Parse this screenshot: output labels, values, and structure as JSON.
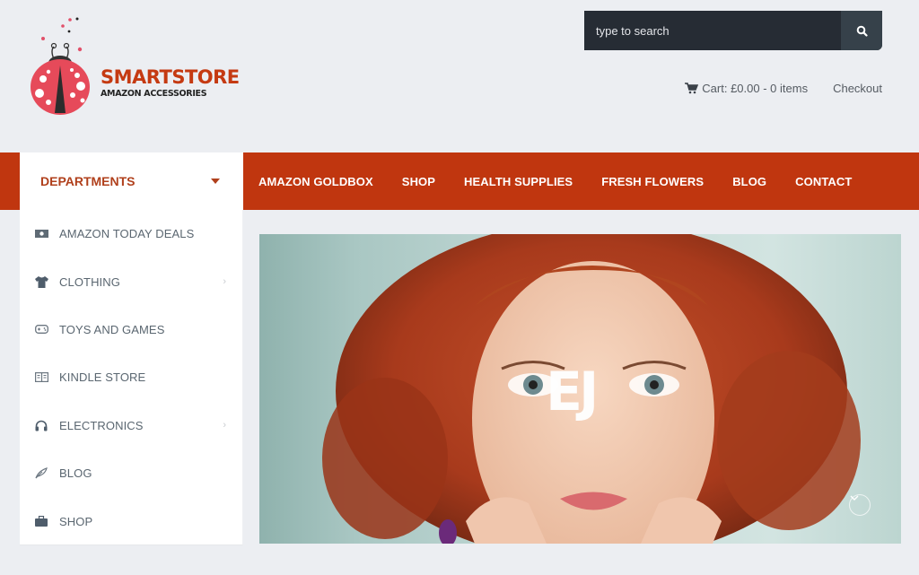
{
  "brand": {
    "name": "SMARTSTORE",
    "tagline": "AMAZON ACCESSORIES",
    "primary_color": "#c0360f",
    "logo_icon": "ladybug-icon"
  },
  "header": {
    "search": {
      "placeholder": "type to search",
      "value": "",
      "icon": "search-icon"
    },
    "cart": {
      "icon": "cart-icon",
      "label": "Cart: £0.00 - 0 items"
    },
    "checkout_label": "Checkout"
  },
  "nav": {
    "departments_label": "DEPARTMENTS",
    "items": [
      {
        "label": "AMAZON GOLDBOX"
      },
      {
        "label": "SHOP"
      },
      {
        "label": "HEALTH SUPPLIES"
      },
      {
        "label": "FRESH FLOWERS"
      },
      {
        "label": "BLOG"
      },
      {
        "label": "CONTACT"
      }
    ]
  },
  "sidebar": {
    "items": [
      {
        "label": "AMAZON TODAY DEALS",
        "icon": "money-icon",
        "has_submenu": false
      },
      {
        "label": "CLOTHING",
        "icon": "tshirt-icon",
        "has_submenu": true
      },
      {
        "label": "TOYS AND GAMES",
        "icon": "gamepad-icon",
        "has_submenu": false
      },
      {
        "label": "KINDLE STORE",
        "icon": "book-icon",
        "has_submenu": false
      },
      {
        "label": "ELECTRONICS",
        "icon": "headphones-icon",
        "has_submenu": true
      },
      {
        "label": "BLOG",
        "icon": "feather-icon",
        "has_submenu": false
      },
      {
        "label": "SHOP",
        "icon": "briefcase-icon",
        "has_submenu": false
      }
    ]
  },
  "hero": {
    "logo_text": "EJ",
    "scroll_icon": "chevron-down-icon"
  }
}
